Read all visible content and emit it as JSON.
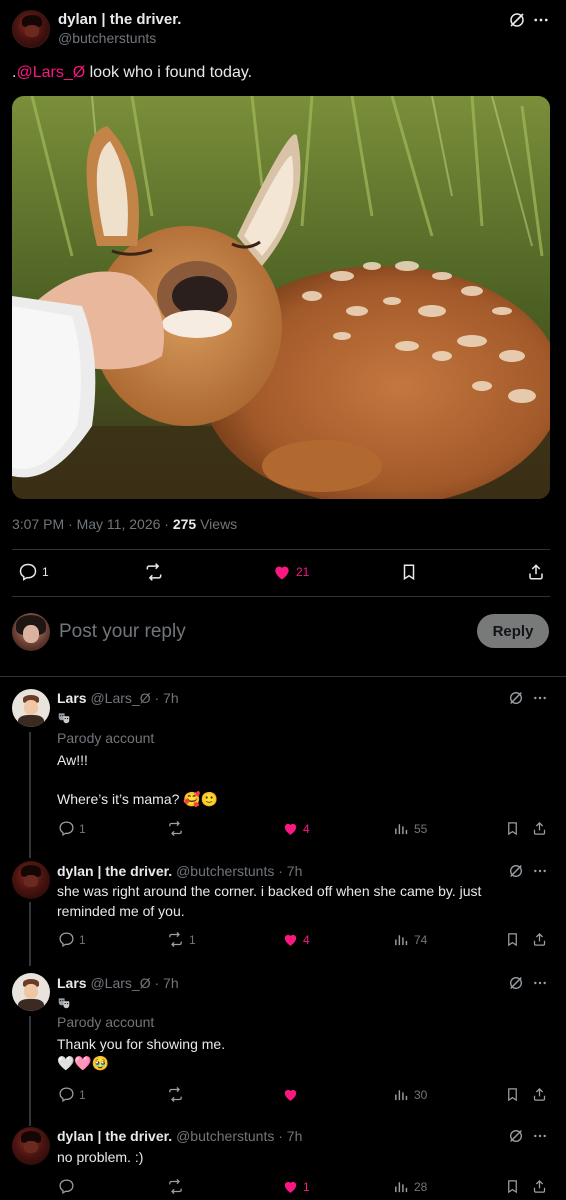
{
  "main_post": {
    "display_name": "dylan | the driver.",
    "handle": "@butcherstunts",
    "text_prefix": ".",
    "mention": "@Lars_Ø",
    "text": " look who i found today.",
    "time": "3:07 PM",
    "date": "May 11, 2026",
    "separator": "·",
    "views_count": "275",
    "views_label": "Views",
    "replies": "1",
    "reposts": "",
    "likes": "21",
    "photo_alt": "sleeping fawn with hand cradling its head"
  },
  "reply_box": {
    "placeholder": "Post your reply",
    "button": "Reply"
  },
  "replies": [
    {
      "display_name": "Lars",
      "handle": "@Lars_Ø",
      "time": "7h",
      "badge_icon": "theater-masks-icon",
      "parody_label": "Parody account",
      "line1": "Aw!!!",
      "line2": "Where’s it’s mama? 🥰🙂",
      "replies": "1",
      "reposts": "",
      "likes": "4",
      "views": "55"
    },
    {
      "display_name": "dylan | the driver.",
      "handle": "@butcherstunts",
      "time": "7h",
      "line1": "she was right around the corner. i backed off when she came by. just",
      "line2": "reminded me of you.",
      "replies": "1",
      "reposts": "1",
      "likes": "4",
      "views": "74"
    },
    {
      "display_name": "Lars",
      "handle": "@Lars_Ø",
      "time": "7h",
      "badge_icon": "theater-masks-icon",
      "parody_label": "Parody account",
      "line1": "Thank you for showing me.",
      "line2": "🤍🩷🥹",
      "replies": "1",
      "reposts": "",
      "likes": "",
      "views": "30"
    },
    {
      "display_name": "dylan | the driver.",
      "handle": "@butcherstunts",
      "time": "7h",
      "line1": "no problem. :)",
      "replies": "",
      "reposts": "",
      "likes": "1",
      "views": "28"
    }
  ],
  "colors": {
    "background": "#000000",
    "text": "#e7e9ea",
    "muted": "#71767b",
    "accent_pink": "#f91880",
    "divider": "#2f3336"
  }
}
